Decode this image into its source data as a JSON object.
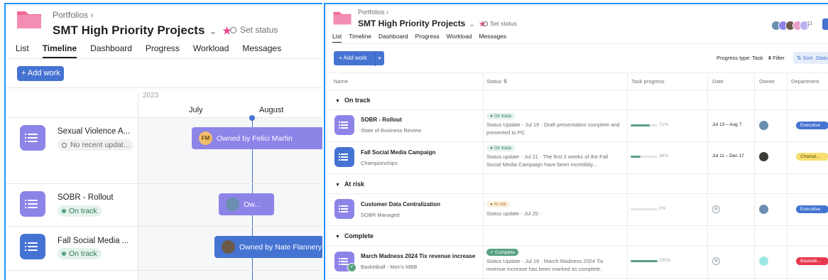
{
  "left": {
    "breadcrumb": "Portfolios",
    "title": "SMT High Priority Projects",
    "set_status": "Set status",
    "tabs": [
      {
        "label": "List"
      },
      {
        "label": "Timeline"
      },
      {
        "label": "Dashboard"
      },
      {
        "label": "Progress"
      },
      {
        "label": "Workload"
      },
      {
        "label": "Messages"
      }
    ],
    "add_work": "+ Add work",
    "timeline": {
      "year": "2023",
      "months": [
        "July",
        "August"
      ]
    },
    "rows": [
      {
        "name": "Sexual Violence A...",
        "status": "No recent updat...",
        "bar_label": "Owned by Felici Martin",
        "avatar_initials": "FM"
      },
      {
        "name": "SOBR - Rollout",
        "status": "On track",
        "bar_label": "Ow..."
      },
      {
        "name": "Fall Social Media ...",
        "status": "On track",
        "bar_label": "Owned by Nate Flannery"
      }
    ]
  },
  "right": {
    "breadcrumb": "Portfolios",
    "title": "SMT High Priority Projects",
    "set_status": "Set status",
    "member_count": "11",
    "tabs": [
      {
        "label": "List"
      },
      {
        "label": "Timeline"
      },
      {
        "label": "Dashboard"
      },
      {
        "label": "Progress"
      },
      {
        "label": "Workload"
      },
      {
        "label": "Messages"
      }
    ],
    "add_work": "+ Add work",
    "toolbar": {
      "progress_type": "Progress type: Task",
      "filter": "Filter",
      "sort": "Sort: Status"
    },
    "columns": {
      "name": "Name",
      "status": "Status",
      "task_progress": "Task progress",
      "date": "Date",
      "owner": "Owner",
      "department": "Department"
    },
    "sections": {
      "on_track": "On track",
      "at_risk": "At risk",
      "complete": "Complete"
    },
    "projects": [
      {
        "name": "SOBR - Rollout",
        "sub": "State of Business Review",
        "pill": "On track",
        "update": "Status Update - Jul 19 · Draft presentation complete and presented to PC",
        "progress": 71,
        "progress_label": "71%",
        "date": "Jul 13 – Aug 7",
        "dept": "Executive"
      },
      {
        "name": "Fall Social Media Campaign",
        "sub": "Championships",
        "pill": "On track",
        "update": "Status update - Jul 21 · The first 2 weeks of the Fall Social Media Campaign have been incredibly...",
        "progress": 36,
        "progress_label": "36%",
        "date": "Jul 11 – Dec 17",
        "dept": "Champi..."
      },
      {
        "name": "Customer Data Centralization",
        "sub": "SOBR Managed",
        "pill": "At risk",
        "update": "Status update - Jul 25 ·",
        "progress": 0,
        "progress_label": "0%",
        "date": "",
        "dept": "Executive"
      },
      {
        "name": "March Madness 2024 Tix revenue increase",
        "sub": "Basketball - Men's MBB",
        "pill": "Complete",
        "update": "Status Update - Jul 19 · March Madness 2024 Tix revenue increase has been marked as complete.",
        "progress": 100,
        "progress_label": "100%",
        "date": "",
        "dept": "Basketb..."
      }
    ]
  },
  "colors": {
    "accent": "#4573d2",
    "project_purple": "#8d84e8",
    "project_blue": "#4573d2",
    "on_track": "#58a182",
    "at_risk": "#f1bd6c",
    "pink_folder": "#f06a99"
  }
}
